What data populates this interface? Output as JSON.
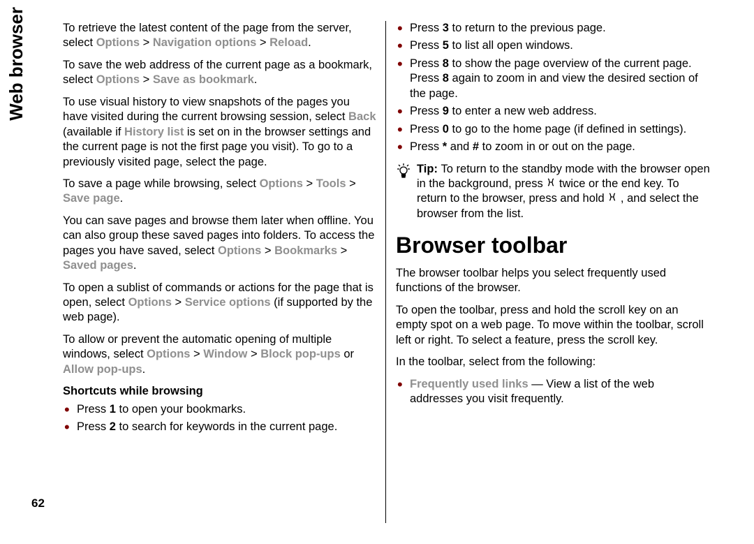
{
  "side_title": "Web browser",
  "page_number": "62",
  "left": {
    "p1_a": "To retrieve the latest content of the page from the server, select ",
    "p1_b": "Options",
    "p1_c": " > ",
    "p1_d": "Navigation options",
    "p1_e": " > ",
    "p1_f": "Reload",
    "p1_g": ".",
    "p2_a": "To save the web address of the current page as a bookmark, select ",
    "p2_b": "Options",
    "p2_c": " > ",
    "p2_d": "Save as bookmark",
    "p2_e": ".",
    "p3_a": "To use visual history to view snapshots of the pages you have visited during the current browsing session, select ",
    "p3_b": "Back",
    "p3_c": " (available if ",
    "p3_d": "History list",
    "p3_e": " is set on in the browser settings and the current page is not the first page you visit). To go to a previously visited page, select the page.",
    "p4_a": "To save a page while browsing, select ",
    "p4_b": "Options",
    "p4_c": " > ",
    "p4_d": "Tools",
    "p4_e": " > ",
    "p4_f": "Save page",
    "p4_g": ".",
    "p5_a": "You can save pages and browse them later when offline. You can also group these saved pages into folders. To access the pages you have saved, select ",
    "p5_b": "Options",
    "p5_c": " > ",
    "p5_d": "Bookmarks",
    "p5_e": " > ",
    "p5_f": "Saved pages",
    "p5_g": ".",
    "p6_a": "To open a sublist of commands or actions for the page that is open, select ",
    "p6_b": "Options",
    "p6_c": " > ",
    "p6_d": "Service options",
    "p6_e": " (if supported by the web page).",
    "p7_a": "To allow or prevent the automatic opening of multiple windows, select ",
    "p7_b": "Options",
    "p7_c": " > ",
    "p7_d": "Window",
    "p7_e": " > ",
    "p7_f": "Block pop-ups",
    "p7_g": " or ",
    "p7_h": "Allow pop-ups",
    "p7_i": ".",
    "shortcuts_head": "Shortcuts while browsing",
    "s1_a": "Press ",
    "s1_b": "1",
    "s1_c": " to open your bookmarks.",
    "s2_a": "Press ",
    "s2_b": "2",
    "s2_c": " to search for keywords in the current page."
  },
  "right": {
    "r1_a": "Press ",
    "r1_b": "3",
    "r1_c": " to return to the previous page.",
    "r2_a": "Press ",
    "r2_b": "5",
    "r2_c": " to list all open windows.",
    "r3_a": "Press ",
    "r3_b": "8",
    "r3_c": " to show the page overview of the current page. Press ",
    "r3_d": "8",
    "r3_e": " again to zoom in and view the desired section of the page.",
    "r4_a": "Press ",
    "r4_b": "9",
    "r4_c": " to enter a new web address.",
    "r5_a": "Press ",
    "r5_b": "0",
    "r5_c": " to go to the home page (if defined in settings).",
    "r6_a": "Press ",
    "r6_b": "*",
    "r6_c": " and ",
    "r6_d": "#",
    "r6_e": " to zoom in or out on the page.",
    "tip_a": "Tip: ",
    "tip_b": "To return to the standby mode with the browser open in the background, press ",
    "tip_c": " twice or the end key. To return to the browser, press and hold ",
    "tip_d": " , and select the browser from the list.",
    "h2": "Browser toolbar",
    "bt1": "The browser toolbar helps you select frequently used functions of the browser.",
    "bt2": "To open the toolbar, press and hold the scroll key on an empty spot on a web page. To move within the toolbar, scroll left or right. To select a feature, press the scroll key.",
    "bt3": "In the toolbar, select from the following:",
    "ful_a": "Frequently used links",
    "ful_b": " — View a list of the web addresses you visit frequently."
  }
}
